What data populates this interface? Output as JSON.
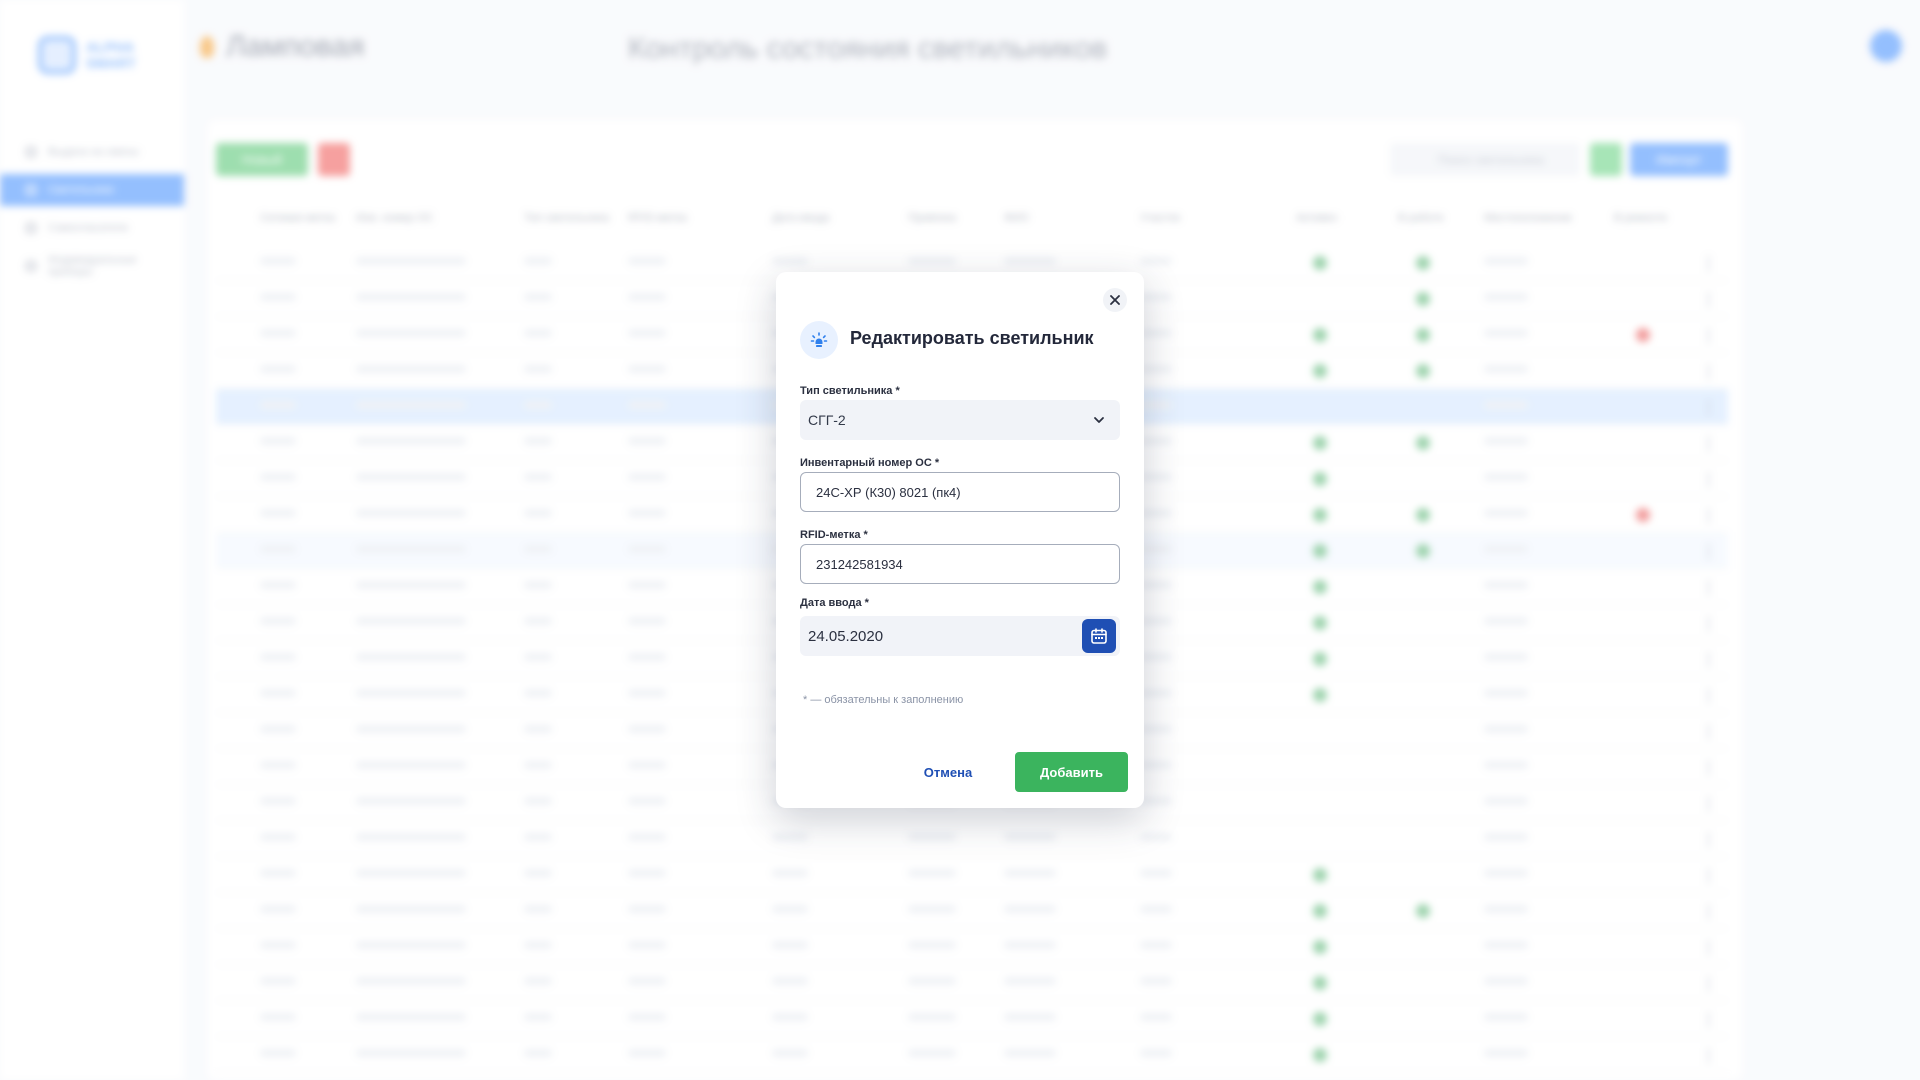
{
  "app": {
    "logo_line1": "ALPHA",
    "logo_line2": "SMART",
    "header_title": "Ламповая",
    "center_title": "Контроль состояния светильников"
  },
  "sidebar": {
    "items": [
      {
        "label": "Выдача на смены"
      },
      {
        "label": "Светильники"
      },
      {
        "label": "Самоспасатели"
      },
      {
        "label": "Индивидуальные приборы"
      }
    ]
  },
  "toolbar": {
    "new_label": "Новый",
    "search_placeholder": "Поиск светильника",
    "import_label": "Импорт"
  },
  "table": {
    "columns": [
      "Сетевая метка",
      "Инв. номер ОС",
      "Тип светильника",
      "RFID-метка",
      "Дата ввода",
      "Привязка",
      "ФИО",
      "Участок",
      "Активен",
      "В работе",
      "Местоположение",
      "В ремонте"
    ]
  },
  "modal": {
    "title": "Редактировать светильник",
    "type_label": "Тип светильника *",
    "type_value": "СГГ-2",
    "inv_label": "Инвентарный номер ОС *",
    "inv_value": "24С-ХР (К30) 8021 (пк4)",
    "rfid_label": "RFID-метка *",
    "rfid_value": "231242581934",
    "date_label": "Дата ввода *",
    "date_value": "24.05.2020",
    "required_note": "*  — обязательны к заполнению",
    "cancel_label": "Отмена",
    "submit_label": "Добавить"
  },
  "colors": {
    "accent": "#1f4fb4",
    "success": "#3bb45e",
    "sidebar_active": "#3d8bfd"
  }
}
